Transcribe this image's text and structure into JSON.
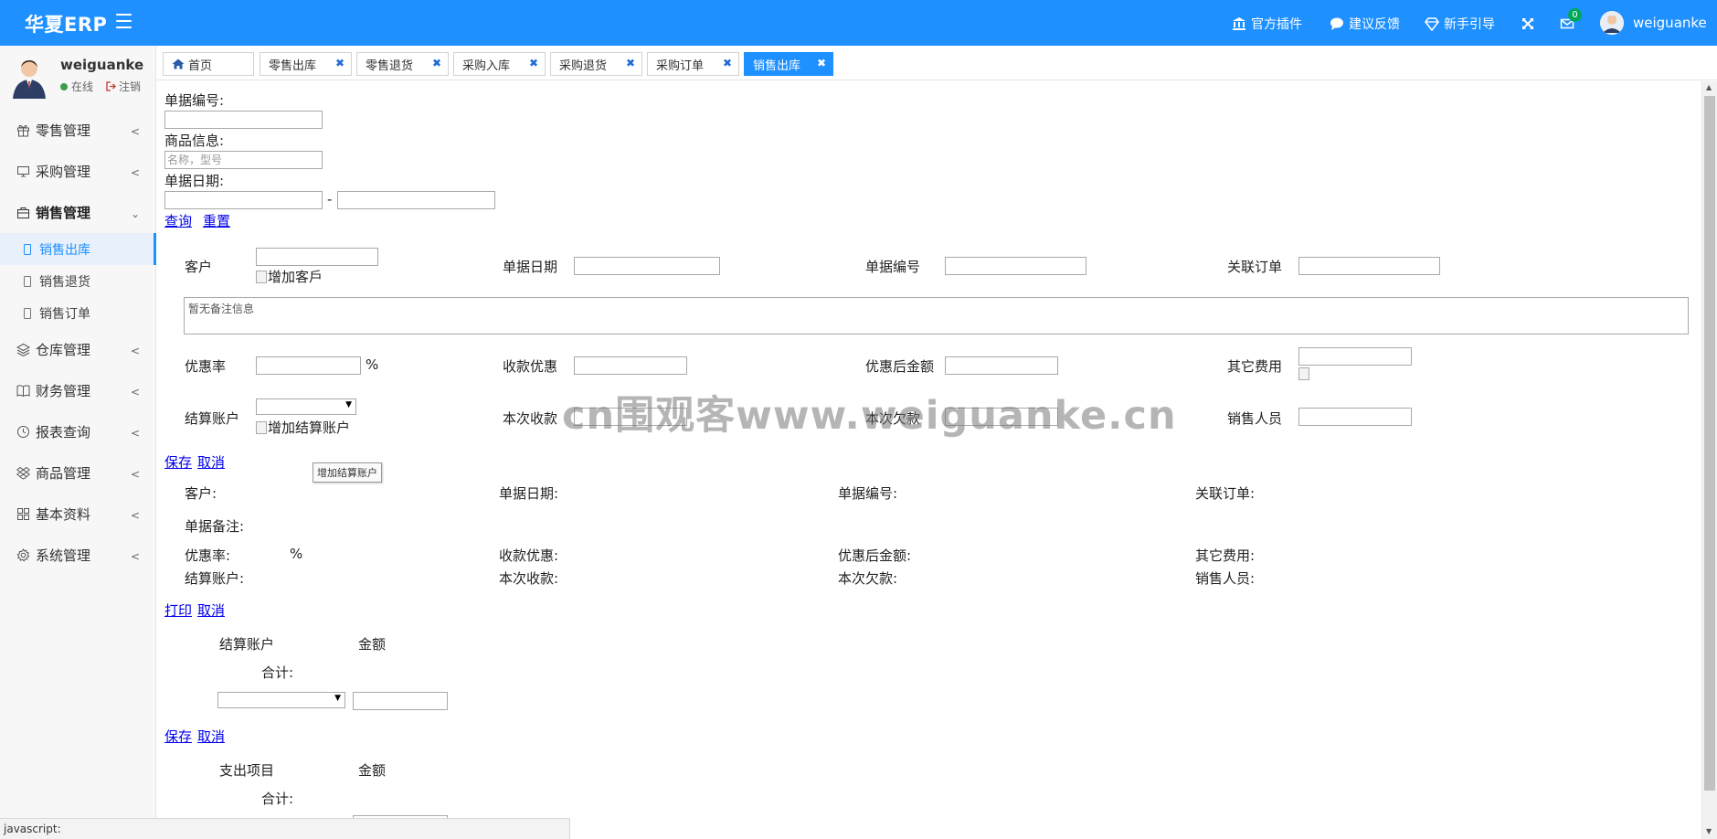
{
  "app": {
    "brand": "华夏ERP"
  },
  "topbar": {
    "items": [
      {
        "label": "官方插件",
        "icon": "bank-icon"
      },
      {
        "label": "建议反馈",
        "icon": "chat-bubble-icon"
      },
      {
        "label": "新手引导",
        "icon": "diamond-icon"
      }
    ],
    "message_count": "0",
    "username": "weiguanke"
  },
  "sidebar": {
    "user": {
      "name": "weiguanke",
      "status": "在线",
      "logout": "注销"
    },
    "menu": [
      {
        "label": "零售管理",
        "icon": "gift-icon"
      },
      {
        "label": "采购管理",
        "icon": "monitor-icon"
      },
      {
        "label": "销售管理",
        "icon": "briefcase-icon",
        "open": true
      },
      {
        "label": "仓库管理",
        "icon": "layers-icon"
      },
      {
        "label": "财务管理",
        "icon": "book-icon"
      },
      {
        "label": "报表查询",
        "icon": "clock-icon"
      },
      {
        "label": "商品管理",
        "icon": "dropbox-icon"
      },
      {
        "label": "基本资料",
        "icon": "grid-icon"
      },
      {
        "label": "系统管理",
        "icon": "gear-icon"
      }
    ],
    "submenu": [
      {
        "label": "销售出库",
        "active": true
      },
      {
        "label": "销售退货"
      },
      {
        "label": "销售订单"
      }
    ]
  },
  "tabs": [
    {
      "label": "首页",
      "home": true
    },
    {
      "label": "零售出库"
    },
    {
      "label": "零售退货"
    },
    {
      "label": "采购入库"
    },
    {
      "label": "采购退货"
    },
    {
      "label": "采购订单"
    },
    {
      "label": "销售出库",
      "active": true
    }
  ],
  "search": {
    "bill_no_label": "单据编号:",
    "goods_info_label": "商品信息:",
    "goods_info_placeholder": "名称，型号",
    "bill_date_label": "单据日期:",
    "date_separator": "-",
    "query": "查询",
    "reset": "重置"
  },
  "edit_form": {
    "customer_label": "客户",
    "add_customer": "增加客戶",
    "bill_date_label": "单据日期",
    "bill_no_label": "单据编号",
    "linked_order_label": "关联订单",
    "remark_placeholder": "暂无备注信息",
    "discount_rate_label": "优惠率",
    "percent": "%",
    "collect_discount_label": "收款优惠",
    "after_discount_label": "优惠后金额",
    "other_fee_label": "其它费用",
    "account_label": "结算账户",
    "add_account": "增加结算账户",
    "this_collect_label": "本次收款",
    "this_debt_label": "本次欠款",
    "salesman_label": "销售人员",
    "save": "保存",
    "cancel": "取消",
    "tooltip": "增加结算账户"
  },
  "view_form": {
    "customer": "客户:",
    "bill_date": "单据日期:",
    "bill_no": "单据编号:",
    "linked_order": "关联订单:",
    "remark": "单据备注:",
    "discount_rate": "优惠率:",
    "percent": "%",
    "collect_discount": "收款优惠:",
    "after_discount": "优惠后金额:",
    "other_fee": "其它费用:",
    "account": "结算账户:",
    "this_collect": "本次收款:",
    "this_debt": "本次欠款:",
    "salesman": "销售人员:",
    "print": "打印",
    "cancel": "取消"
  },
  "account_table": {
    "col_account": "结算账户",
    "col_amount": "金额",
    "total": "合计:",
    "save": "保存",
    "cancel": "取消"
  },
  "expense_table": {
    "col_item": "支出项目",
    "col_amount": "金额",
    "total": "合计:"
  },
  "watermark": "cn围观客www.weiguanke.cn",
  "statusbar": "javascript:"
}
